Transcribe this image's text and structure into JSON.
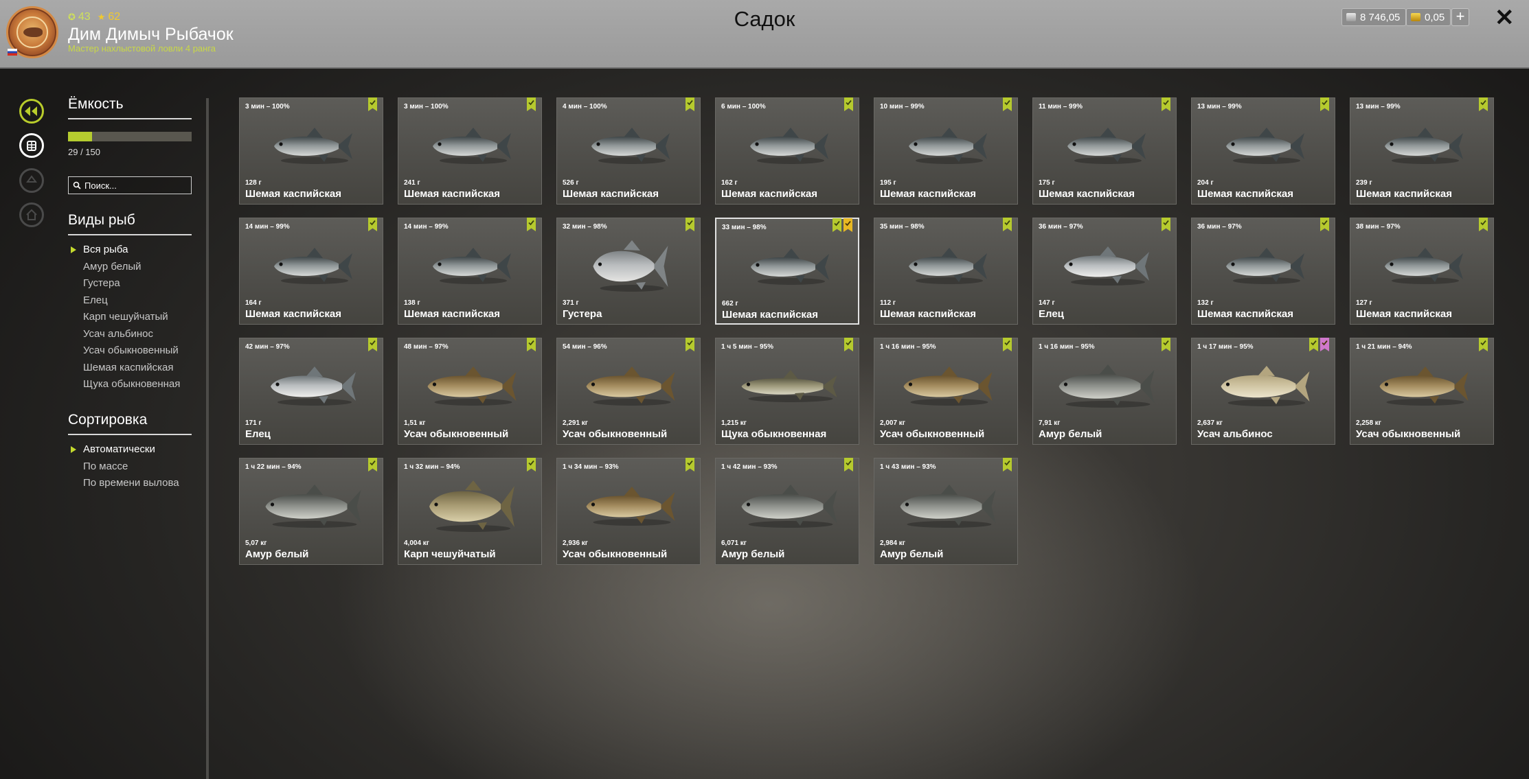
{
  "header": {
    "title": "Садок",
    "player_name": "Дим Димыч Рыбачок",
    "player_rank": "Мастер нахлыстовой ловли 4 ранга",
    "level": "43",
    "stars": "62",
    "silver": "8 746,05",
    "gold": "0,05",
    "plus_label": "+",
    "close_label": "✕"
  },
  "sidebar": {
    "capacity_title": "Ёмкость",
    "capacity_count": "29 / 150",
    "capacity_fraction": 0.193,
    "search_placeholder": "Поиск...",
    "species_title": "Виды рыб",
    "species": [
      "Вся рыба",
      "Амур белый",
      "Густера",
      "Елец",
      "Карп чешуйчатый",
      "Усач альбинос",
      "Усач обыкновенный",
      "Шемая каспийская",
      "Щука обыкновенная"
    ],
    "sort_title": "Сортировка",
    "sort_options": [
      "Автоматически",
      "По массе",
      "По времени вылова"
    ]
  },
  "fish_cards": [
    {
      "time": "3 мин – 100%",
      "weight": "128 г",
      "name": "Шемая каспийская",
      "kind": "shemaya",
      "badges": [
        "green"
      ]
    },
    {
      "time": "3 мин – 100%",
      "weight": "241 г",
      "name": "Шемая каспийская",
      "kind": "shemaya",
      "badges": [
        "green"
      ]
    },
    {
      "time": "4 мин – 100%",
      "weight": "526 г",
      "name": "Шемая каспийская",
      "kind": "shemaya",
      "badges": [
        "green"
      ]
    },
    {
      "time": "6 мин – 100%",
      "weight": "162 г",
      "name": "Шемая каспийская",
      "kind": "shemaya",
      "badges": [
        "green"
      ]
    },
    {
      "time": "10 мин – 99%",
      "weight": "195 г",
      "name": "Шемая каспийская",
      "kind": "shemaya",
      "badges": [
        "green"
      ]
    },
    {
      "time": "11 мин – 99%",
      "weight": "175 г",
      "name": "Шемая каспийская",
      "kind": "shemaya",
      "badges": [
        "green"
      ]
    },
    {
      "time": "13 мин – 99%",
      "weight": "204 г",
      "name": "Шемая каспийская",
      "kind": "shemaya",
      "badges": [
        "green"
      ]
    },
    {
      "time": "13 мин – 99%",
      "weight": "239 г",
      "name": "Шемая каспийская",
      "kind": "shemaya",
      "badges": [
        "green"
      ]
    },
    {
      "time": "14 мин – 99%",
      "weight": "164 г",
      "name": "Шемая каспийская",
      "kind": "shemaya",
      "badges": [
        "green"
      ]
    },
    {
      "time": "14 мин – 99%",
      "weight": "138 г",
      "name": "Шемая каспийская",
      "kind": "shemaya",
      "badges": [
        "green"
      ]
    },
    {
      "time": "32 мин – 98%",
      "weight": "371 г",
      "name": "Густера",
      "kind": "gustera",
      "badges": [
        "green"
      ]
    },
    {
      "time": "33 мин – 98%",
      "weight": "662 г",
      "name": "Шемая каспийская",
      "kind": "shemaya",
      "badges": [
        "green",
        "yellow"
      ],
      "selected": true
    },
    {
      "time": "35 мин – 98%",
      "weight": "112 г",
      "name": "Шемая каспийская",
      "kind": "shemaya",
      "badges": [
        "green"
      ]
    },
    {
      "time": "36 мин – 97%",
      "weight": "147 г",
      "name": "Елец",
      "kind": "elets",
      "badges": [
        "green"
      ]
    },
    {
      "time": "36 мин – 97%",
      "weight": "132 г",
      "name": "Шемая каспийская",
      "kind": "shemaya",
      "badges": [
        "green"
      ]
    },
    {
      "time": "38 мин – 97%",
      "weight": "127 г",
      "name": "Шемая каспийская",
      "kind": "shemaya",
      "badges": [
        "green"
      ]
    },
    {
      "time": "42 мин – 97%",
      "weight": "171 г",
      "name": "Елец",
      "kind": "elets",
      "badges": [
        "green"
      ]
    },
    {
      "time": "48 мин – 97%",
      "weight": "1,51 кг",
      "name": "Усач обыкновенный",
      "kind": "usach",
      "badges": [
        "green"
      ]
    },
    {
      "time": "54 мин – 96%",
      "weight": "2,291 кг",
      "name": "Усач обыкновенный",
      "kind": "usach",
      "badges": [
        "green"
      ]
    },
    {
      "time": "1 ч 5 мин – 95%",
      "weight": "1,215 кг",
      "name": "Щука обыкновенная",
      "kind": "shchuka",
      "badges": [
        "green"
      ]
    },
    {
      "time": "1 ч 16 мин – 95%",
      "weight": "2,007 кг",
      "name": "Усач обыкновенный",
      "kind": "usach",
      "badges": [
        "green"
      ]
    },
    {
      "time": "1 ч 16 мин – 95%",
      "weight": "7,91 кг",
      "name": "Амур белый",
      "kind": "amur",
      "badges": [
        "green"
      ]
    },
    {
      "time": "1 ч 17 мин – 95%",
      "weight": "2,637 кг",
      "name": "Усач альбинос",
      "kind": "albinos",
      "badges": [
        "green",
        "pink"
      ]
    },
    {
      "time": "1 ч 21 мин – 94%",
      "weight": "2,258 кг",
      "name": "Усач обыкновенный",
      "kind": "usach",
      "badges": [
        "green"
      ]
    },
    {
      "time": "1 ч 22 мин – 94%",
      "weight": "5,07 кг",
      "name": "Амур белый",
      "kind": "amur",
      "badges": [
        "green"
      ]
    },
    {
      "time": "1 ч 32 мин – 94%",
      "weight": "4,004 кг",
      "name": "Карп чешуйчатый",
      "kind": "karp",
      "badges": [
        "green"
      ]
    },
    {
      "time": "1 ч 34 мин – 93%",
      "weight": "2,936 кг",
      "name": "Усач обыкновенный",
      "kind": "usach",
      "badges": [
        "green"
      ]
    },
    {
      "time": "1 ч 42 мин – 93%",
      "weight": "6,071 кг",
      "name": "Амур белый",
      "kind": "amur",
      "badges": [
        "green"
      ]
    },
    {
      "time": "1 ч 43 мин – 93%",
      "weight": "2,984 кг",
      "name": "Амур белый",
      "kind": "amur",
      "badges": [
        "green"
      ]
    }
  ],
  "colors": {
    "accent": "#b6ca2e",
    "badge_yellow": "#e8b823",
    "badge_pink": "#d078cc"
  },
  "icons": {
    "rail": [
      "back-arrow-icon",
      "keepnet-icon",
      "boat-icon",
      "home-icon"
    ],
    "silver": "silver-coin-icon",
    "gold": "gold-coin-icon",
    "search": "search-icon",
    "close": "close-icon"
  }
}
